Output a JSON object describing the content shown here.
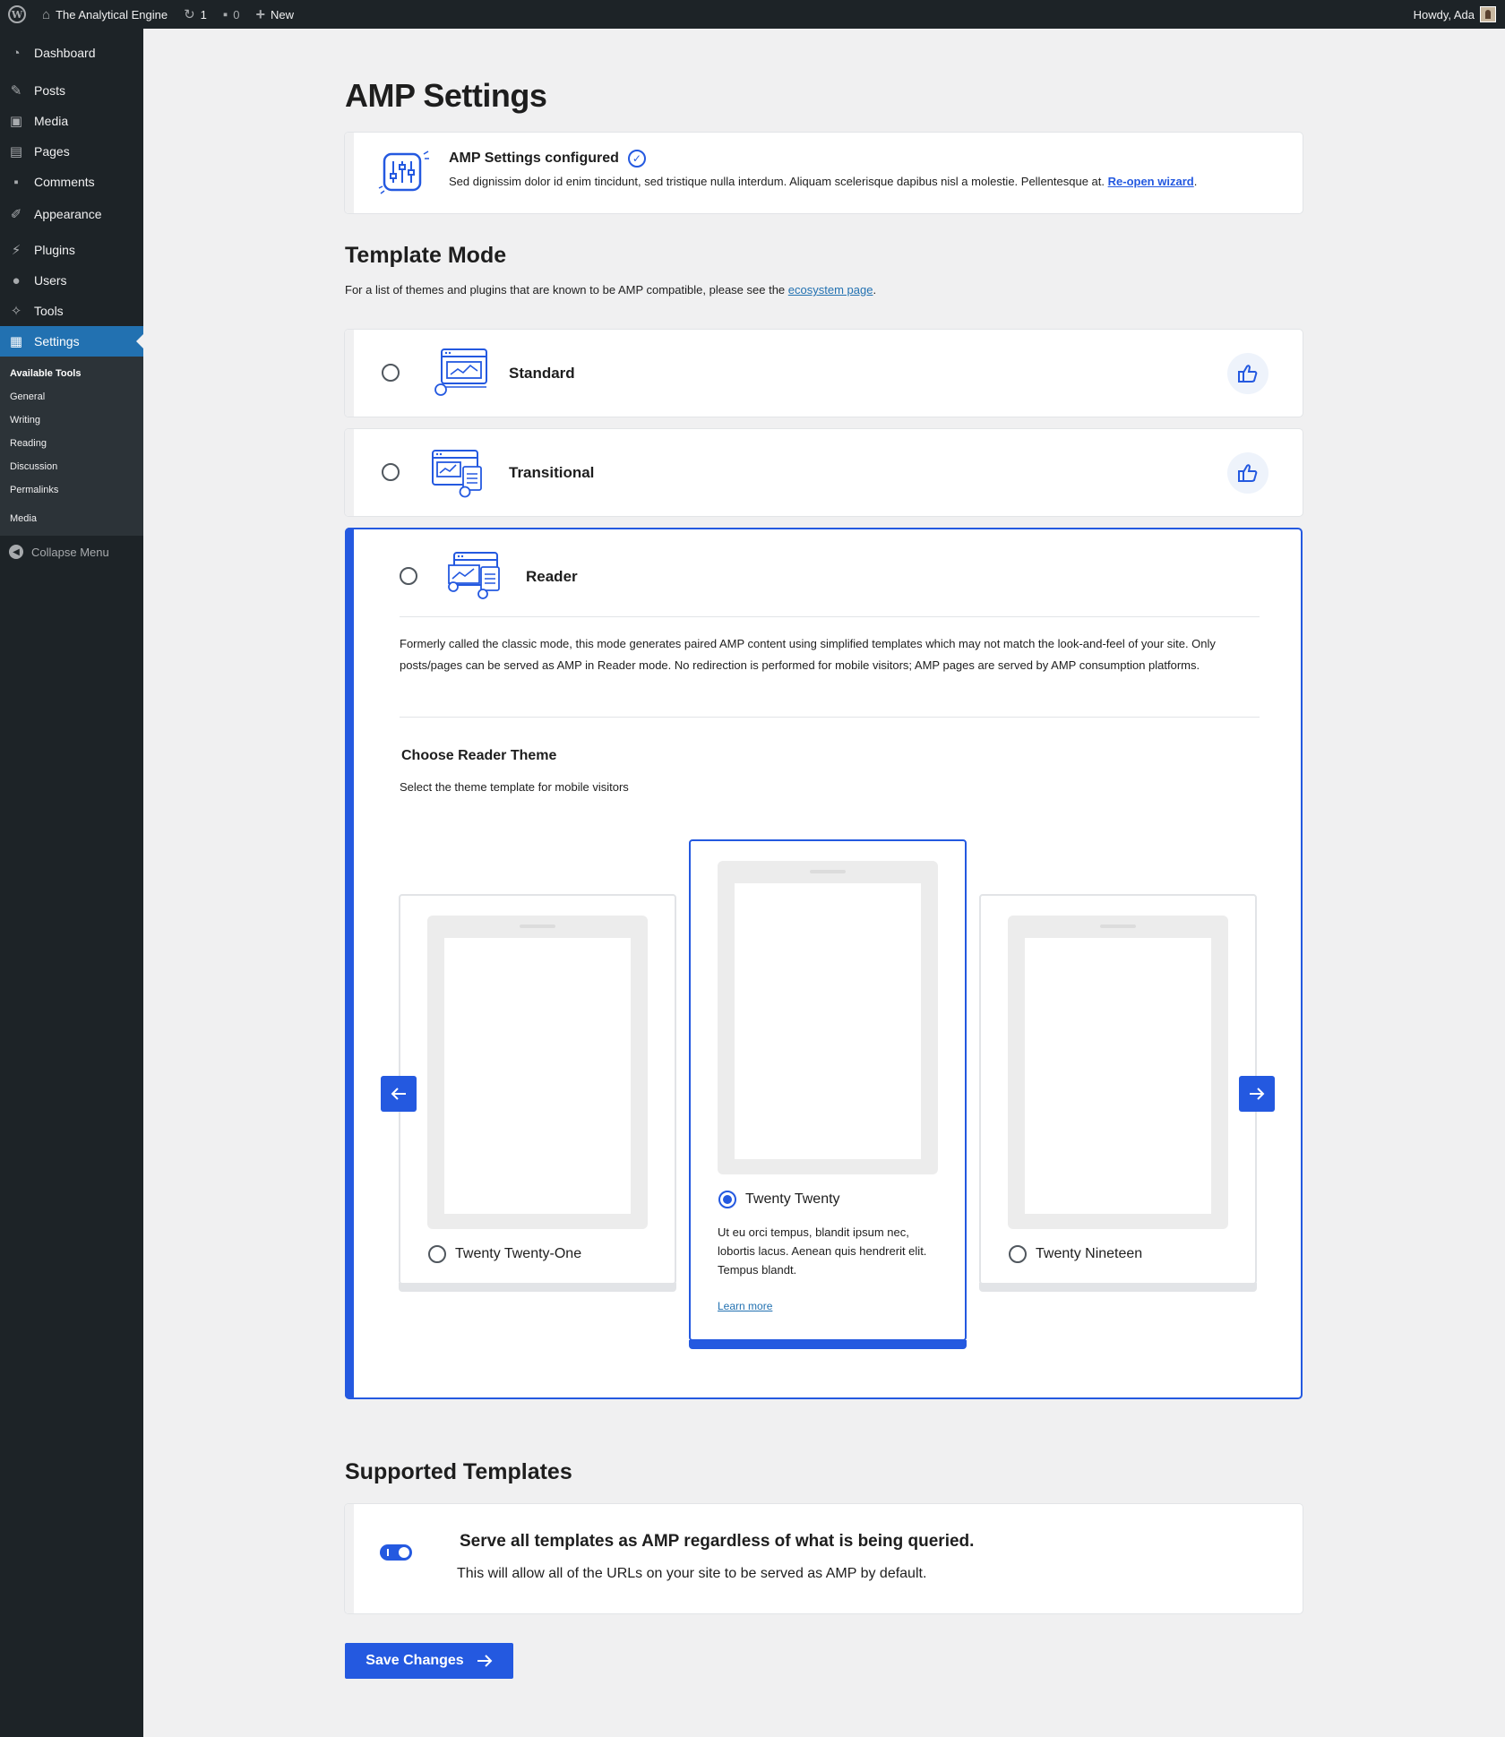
{
  "adminbar": {
    "site_name": "The Analytical Engine",
    "updates_count": "1",
    "comments_count": "0",
    "new_label": "New",
    "greeting": "Howdy, Ada"
  },
  "sidebar": {
    "items": [
      {
        "label": "Dashboard",
        "icon": "dashboard-icon"
      },
      {
        "label": "Posts",
        "icon": "pin-icon"
      },
      {
        "label": "Media",
        "icon": "media-icon"
      },
      {
        "label": "Pages",
        "icon": "pages-icon"
      },
      {
        "label": "Comments",
        "icon": "comment-icon"
      },
      {
        "label": "Appearance",
        "icon": "brush-icon"
      },
      {
        "label": "Plugins",
        "icon": "plugin-icon"
      },
      {
        "label": "Users",
        "icon": "user-icon"
      },
      {
        "label": "Tools",
        "icon": "wrench-icon"
      },
      {
        "label": "Settings",
        "icon": "settings-icon"
      }
    ],
    "submenu": [
      "Available Tools",
      "General",
      "Writing",
      "Reading",
      "Discussion",
      "Permalinks",
      "Media"
    ],
    "collapse_label": "Collapse Menu"
  },
  "page": {
    "title": "AMP Settings"
  },
  "configured": {
    "title": "AMP Settings configured",
    "description": "Sed dignissim dolor id enim tincidunt, sed tristique nulla interdum. Aliquam scelerisque dapibus nisl a molestie. Pellentesque at. ",
    "link": "Re-open wizard",
    "after_link": "."
  },
  "template_mode": {
    "title": "Template Mode",
    "description": "For a list of themes and plugins that are known to be AMP compatible, please see the ",
    "link": "ecosystem page",
    "after_link": ".",
    "modes": [
      {
        "label": "Standard",
        "recommended": true
      },
      {
        "label": "Transitional",
        "recommended": true
      },
      {
        "label": "Reader",
        "recommended": false
      }
    ],
    "reader_description": "Formerly called the classic mode, this mode generates paired AMP content using simplified templates which may not match the look-and-feel of your site. Only posts/pages can be served as AMP in Reader mode. No redirection is performed for mobile visitors; AMP pages are served by AMP consumption platforms."
  },
  "reader_theme": {
    "title": "Choose Reader Theme",
    "description": "Select the theme template for mobile visitors",
    "themes": [
      {
        "name": "Twenty Twenty-One",
        "selected": false
      },
      {
        "name": "Twenty Twenty",
        "selected": true,
        "description": "Ut eu orci tempus, blandit ipsum nec, lobortis lacus. Aenean quis hendrerit elit. Tempus blandt.",
        "learn_more": "Learn more"
      },
      {
        "name": "Twenty Nineteen",
        "selected": false
      }
    ]
  },
  "supported_templates": {
    "title": "Supported Templates",
    "toggle_title": "Serve all templates as AMP regardless of what is being queried.",
    "toggle_description": "This will allow all of the URLs on your site to be served as AMP by default.",
    "toggle_on": true
  },
  "save_label": "Save Changes",
  "colors": {
    "accent": "#2459e0",
    "admin_bar": "#1d2327",
    "sidebar_active": "#2271b1",
    "background": "#f0f0f1"
  }
}
